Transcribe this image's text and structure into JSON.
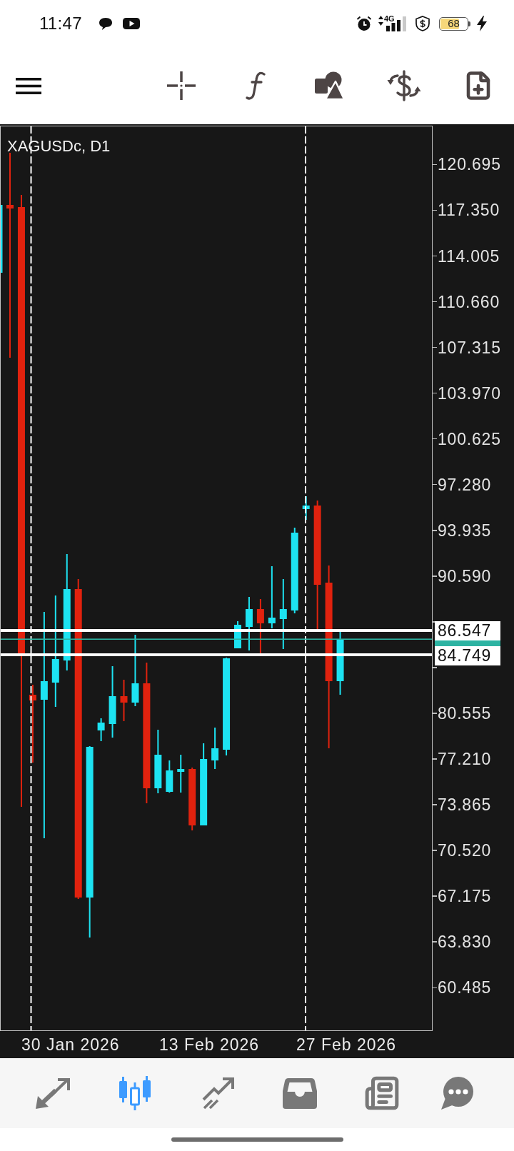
{
  "status_bar": {
    "time": "11:47",
    "network": "4G",
    "battery": "68"
  },
  "chart": {
    "symbol": "XAGUSDc, D1",
    "price_axis": [
      "120.695",
      "117.350",
      "114.005",
      "110.660",
      "107.315",
      "103.970",
      "100.625",
      "97.280",
      "93.935",
      "90.590",
      "80.555",
      "77.210",
      "73.865",
      "70.520",
      "67.175",
      "63.830",
      "60.485"
    ],
    "price_tags": [
      "86.547",
      "84.749"
    ],
    "time_axis": [
      "30 Jan 2026",
      "13 Feb 2026",
      "27 Feb 2026"
    ]
  },
  "nav_tabs": [
    {
      "kind": "quotes",
      "selected": false
    },
    {
      "kind": "chart",
      "selected": true
    },
    {
      "kind": "trade",
      "selected": false
    },
    {
      "kind": "history",
      "selected": false
    },
    {
      "kind": "news",
      "selected": false
    },
    {
      "kind": "messages",
      "selected": false
    }
  ]
}
